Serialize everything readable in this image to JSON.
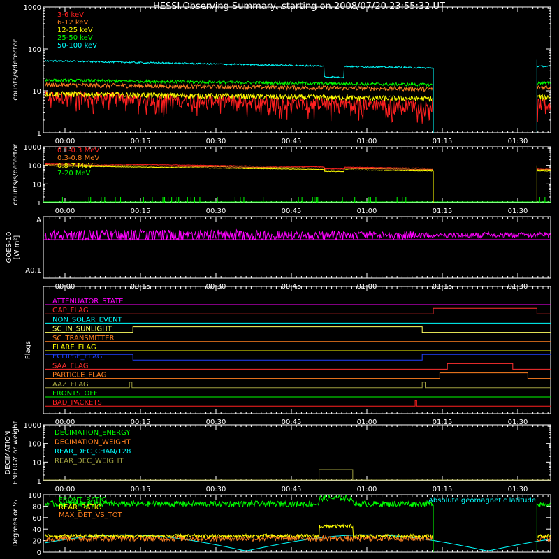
{
  "title": "HESSI Observing Summary, starting on 2008/07/20 23:55:32 UT",
  "time_ticks": [
    "00:00",
    "00:15",
    "00:30",
    "00:45",
    "01:00",
    "01:15",
    "01:30"
  ],
  "chart_data": [
    {
      "type": "line",
      "panel": "rates-low",
      "ylabel": "counts/s/detector",
      "yscale": "log",
      "ylim": [
        1,
        1000
      ],
      "yticks": [
        "1",
        "10",
        "100",
        "1000"
      ],
      "series": [
        {
          "name": "3-6 keV",
          "color": "#ff2020",
          "base": 7.5,
          "end": 4.5,
          "noise": 0.35
        },
        {
          "name": "6-12 keV",
          "color": "#ff8020",
          "base": 14,
          "end": 11,
          "noise": 0.12
        },
        {
          "name": "12-25 keV",
          "color": "#ffff00",
          "base": 8.5,
          "end": 6.5,
          "noise": 0.15
        },
        {
          "name": "25-50 keV",
          "color": "#00ff00",
          "base": 18,
          "end": 14,
          "noise": 0.08
        },
        {
          "name": "50-100 keV",
          "color": "#00ffff",
          "base": 52,
          "end": 35,
          "noise": 0.04
        }
      ]
    },
    {
      "type": "line",
      "panel": "rates-high",
      "ylabel": "counts/s/detector",
      "yscale": "log",
      "ylim": [
        1,
        1000
      ],
      "yticks": [
        "1",
        "10",
        "100",
        "1000"
      ],
      "series": [
        {
          "name": "0.1-0.3 MeV",
          "color": "#ff2020",
          "base": 130,
          "end": 70,
          "noise": 0.03
        },
        {
          "name": "0.3-0.8 MeV",
          "color": "#ff8020",
          "base": 110,
          "end": 60,
          "noise": 0.03
        },
        {
          "name": "0.8-7 MeV",
          "color": "#ffff00",
          "base": 95,
          "end": 50,
          "noise": 0.03
        },
        {
          "name": "7-20 MeV",
          "color": "#00ff00",
          "base": 1,
          "end": 1,
          "noise": 0
        }
      ]
    },
    {
      "type": "line",
      "panel": "goes",
      "ylabel": "GOES-10",
      "yunit": "[W m²]",
      "yticks": [
        "A0.1",
        "A"
      ],
      "series": [
        {
          "name": "GOES-10",
          "color": "#ff00ff"
        }
      ]
    },
    {
      "type": "line",
      "panel": "flags",
      "ylabel": "Flags",
      "series": [
        {
          "name": "ATTENUATOR_STATE",
          "color": "#ff00ff"
        },
        {
          "name": "GAP_FLAG",
          "color": "#ff3030"
        },
        {
          "name": "NON_SOLAR_EVENT",
          "color": "#00ffff"
        },
        {
          "name": "SC_IN_SUNLIGHT",
          "color": "#ffff60"
        },
        {
          "name": "SC_TRANSMITTER",
          "color": "#ff8020"
        },
        {
          "name": "FLARE_FLAG",
          "color": "#ffff00"
        },
        {
          "name": "ECLIPSE_FLAG",
          "color": "#2040ff"
        },
        {
          "name": "SAA_FLAG",
          "color": "#ff3030"
        },
        {
          "name": "PARTICLE_FLAG",
          "color": "#ff8020"
        },
        {
          "name": "AAZ_FLAG",
          "color": "#a0a040"
        },
        {
          "name": "FRONTS_OFF",
          "color": "#00ff00"
        },
        {
          "name": "BAD_PACKETS",
          "color": "#ff2020"
        }
      ]
    },
    {
      "type": "line",
      "panel": "decimation",
      "ylabel": "DECIMATION",
      "ylabel2": "ENERGY or weight",
      "yscale": "log",
      "ylim": [
        1,
        1000
      ],
      "yticks": [
        "1",
        "10",
        "100",
        "1000"
      ],
      "series": [
        {
          "name": "DECIMATION_ENERGY",
          "color": "#00ff00"
        },
        {
          "name": "DECIMATION_WEIGHT",
          "color": "#ff8020"
        },
        {
          "name": "REAR_DEC_CHAN/128",
          "color": "#00ffff"
        },
        {
          "name": "REAR_DEC_WEIGHT",
          "color": "#a0a040"
        }
      ]
    },
    {
      "type": "line",
      "panel": "ratios",
      "ylabel": "Degrees or %",
      "ylim": [
        0,
        100
      ],
      "yticks": [
        "0",
        "20",
        "40",
        "60",
        "80",
        "100"
      ],
      "series": [
        {
          "name": "FRONT_RATIO",
          "color": "#00ff00"
        },
        {
          "name": "REAR_RATIO",
          "color": "#ffff00"
        },
        {
          "name": "MAX_DET_VS_TOT",
          "color": "#ff8020"
        },
        {
          "name": "Absolute geomagnetic latitude",
          "color": "#00ffff"
        }
      ]
    }
  ]
}
